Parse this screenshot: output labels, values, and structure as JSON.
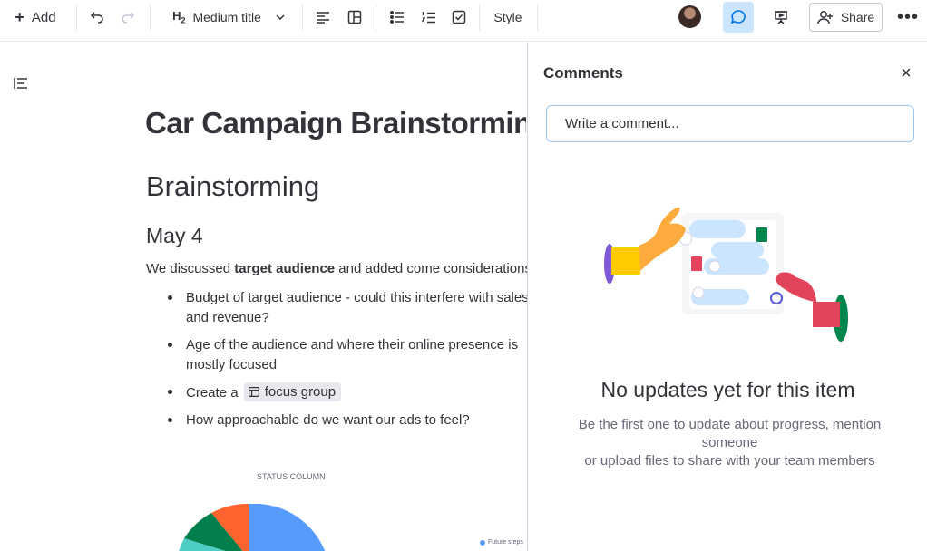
{
  "toolbar": {
    "add_label": "Add",
    "heading_label": "Medium title",
    "heading_badge": "H",
    "heading_badge_sub": "2",
    "style_label": "Style",
    "share_label": "Share",
    "more_label": "•••"
  },
  "document": {
    "title": "Car Campaign Brainstorming",
    "heading": "Brainstorming",
    "subheading": "May 4",
    "paragraph_prefix": "We discussed ",
    "paragraph_bold": "target audience",
    "paragraph_suffix": " and added come considerations",
    "bullets": [
      "Budget of target audience - could this interfere with sales",
      "and revenue?",
      "Age of the audience and where their online presence is",
      "mostly focused",
      "Create a ",
      "focus group",
      "How approachable do we want our ads to feel?"
    ],
    "chart_title": "STATUS COLUMN",
    "legend_label": "Future steps"
  },
  "chart_data": {
    "type": "pie",
    "title": "STATUS COLUMN",
    "legend": [
      "Future steps"
    ],
    "colors": [
      "#579bfc",
      "#ff642e",
      "#037f4c",
      "#4eccc6"
    ]
  },
  "comments": {
    "title": "Comments",
    "close_label": "×",
    "input_placeholder": "Write a comment...",
    "empty_title": "No updates yet for this item",
    "empty_line1": "Be the first one to update about progress, mention someone",
    "empty_line2": "or upload files to share with your team members"
  },
  "colors": {
    "accent": "#0073ea",
    "comment_active_bg": "#cce5ff",
    "input_border": "#9ec5ef"
  },
  "icons": [
    "plus-icon",
    "undo-icon",
    "redo-icon",
    "chevron-down-icon",
    "align-left-icon",
    "layout-icon",
    "bullet-list-icon",
    "numbered-list-icon",
    "checklist-icon",
    "comment-icon",
    "presentation-icon",
    "add-person-icon",
    "table-of-contents-icon",
    "board-icon",
    "close-icon"
  ]
}
